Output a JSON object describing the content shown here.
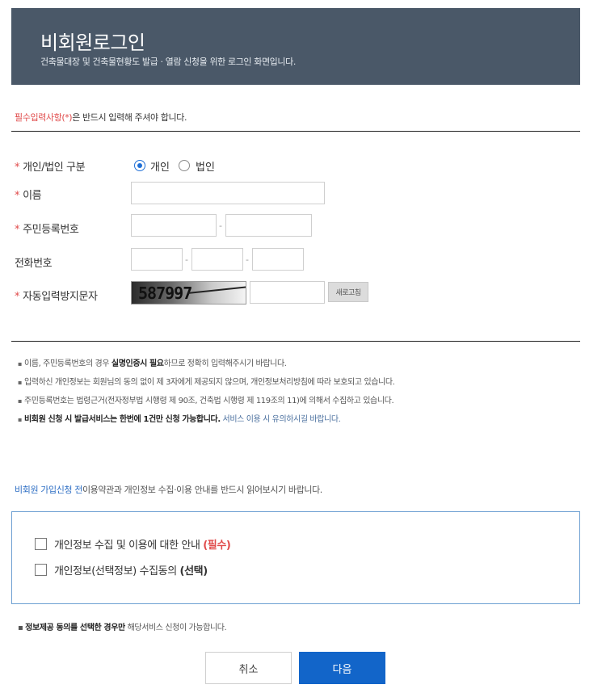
{
  "header": {
    "title": "비회원로그인",
    "subtitle": "건축물대장 및 건축물현황도 발급 · 열람 신청을 위한 로그인 화면입니다."
  },
  "required_note": {
    "highlight": "필수입력사항(*)",
    "text": "은 반드시 입력해 주셔야 합니다."
  },
  "form": {
    "type_label": "개인/법인 구분",
    "type_options": [
      "개인",
      "법인"
    ],
    "type_selected": "개인",
    "name_label": "이름",
    "rrn_label": "주민등록번호",
    "phone_label": "전화번호",
    "captcha_label": "자동입력방지문자",
    "captcha_code": "587997",
    "refresh_label": "새로고침",
    "dash": "-"
  },
  "notes": [
    {
      "pre": "이름, 주민등록번호의 경우 ",
      "bold": "실명인증시 필요",
      "post": "하므로 정확히 입력해주시기 바랍니다."
    },
    {
      "pre": "입력하신 개인정보는 회원님의 동의 없이 제 3자에게 제공되지 않으며, 개인정보처리방침에 따라 보호되고 있습니다.",
      "bold": "",
      "post": ""
    },
    {
      "pre": "주민등록번호는 법령근거(전자정부법 시행령 제 90조, 건축법 시행령 제 119조의 11)에 의해서 수집하고 있습니다.",
      "bold": "",
      "post": ""
    },
    {
      "pre": "",
      "bold": "비회원 신청 시 발급서비스는 한번에 1건만 신청 가능합니다.",
      "post": " 서비스 이용 시 유의하시길 바랍니다."
    }
  ],
  "apply_note": {
    "highlight": "비회원 가입신청 전",
    "text": "이용약관과 개인정보 수집·이용 안내를 반드시 읽어보시기 바랍니다."
  },
  "agreements": [
    {
      "text": "개인정보 수집 및 이용에 대한 안내 ",
      "tag": "(필수)",
      "checked": false
    },
    {
      "text": "개인정보(선택정보) 수집동의 ",
      "tag": "(선택)",
      "checked": false
    }
  ],
  "foot_note": {
    "bold": "정보제공 동의를 선택한 경우만",
    "text": " 해당서비스 신청이 가능합니다."
  },
  "buttons": {
    "cancel": "취소",
    "next": "다음"
  },
  "colors": {
    "header_bg": "#4a5868",
    "required_red": "#e04a4a",
    "primary_blue": "#1265c9"
  }
}
